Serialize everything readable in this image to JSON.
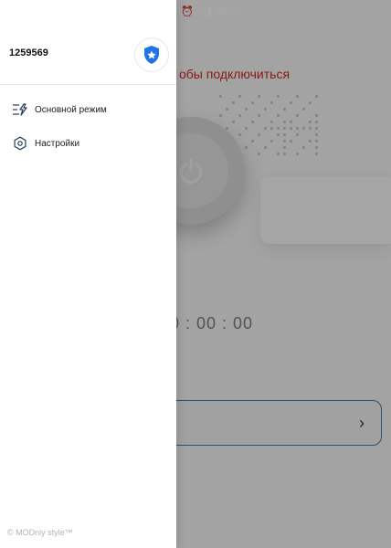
{
  "status_bar": {
    "battery": "28%",
    "alarm_icon": "alarm-icon",
    "wifi_icon": "wifi-icon",
    "signal_icon": "signal-icon"
  },
  "main": {
    "connect_hint": "обы подключиться",
    "timer": "0 : 00 : 00",
    "power_icon": "power-icon",
    "server_chevron": "›"
  },
  "drawer": {
    "account_id": "1259569",
    "badge_icon": "shield-star-icon",
    "items": [
      {
        "label": "Основной режим",
        "icon": "lightning-mode-icon"
      },
      {
        "label": "Настройки",
        "icon": "settings-hex-icon"
      }
    ],
    "footer": "© MODniy style™"
  },
  "colors": {
    "accent": "#1f73e6",
    "danger": "#d12a1e",
    "border": "#4b79b4",
    "overlay": "#000000"
  }
}
